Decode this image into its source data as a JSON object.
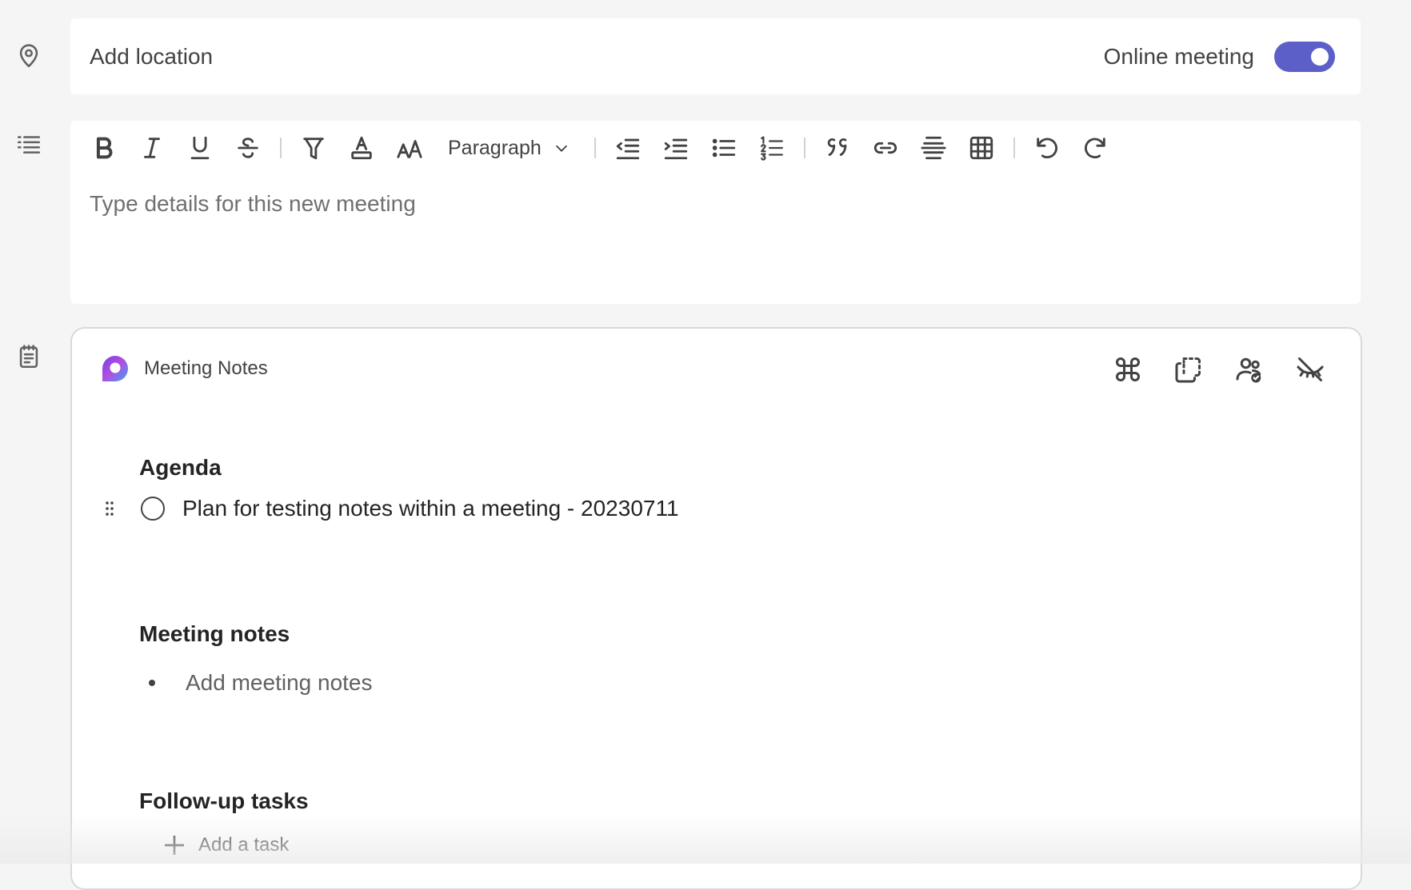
{
  "location": {
    "placeholder": "Add location",
    "online_meeting_label": "Online meeting",
    "online_meeting_enabled": true
  },
  "editor": {
    "paragraph_style": "Paragraph",
    "details_placeholder": "Type details for this new meeting",
    "toolbar_icons": [
      "bold-icon",
      "italic-icon",
      "underline-icon",
      "strikethrough-icon",
      "highlight-icon",
      "font-color-icon",
      "font-size-icon",
      "paragraph-dropdown",
      "decrease-indent-icon",
      "increase-indent-icon",
      "bullet-list-icon",
      "numbered-list-icon",
      "quote-icon",
      "link-icon",
      "horizontal-rule-icon",
      "table-icon",
      "undo-icon",
      "redo-icon"
    ]
  },
  "notes": {
    "title": "Meeting Notes",
    "sections": {
      "agenda_heading": "Agenda",
      "agenda_item": "Plan for testing notes within a meeting - 20230711",
      "notes_heading": "Meeting notes",
      "notes_placeholder": "Add meeting notes",
      "tasks_heading": "Follow-up tasks",
      "add_task_label": "Add a task"
    },
    "colors": {
      "accent": "#5b5fc7"
    }
  }
}
